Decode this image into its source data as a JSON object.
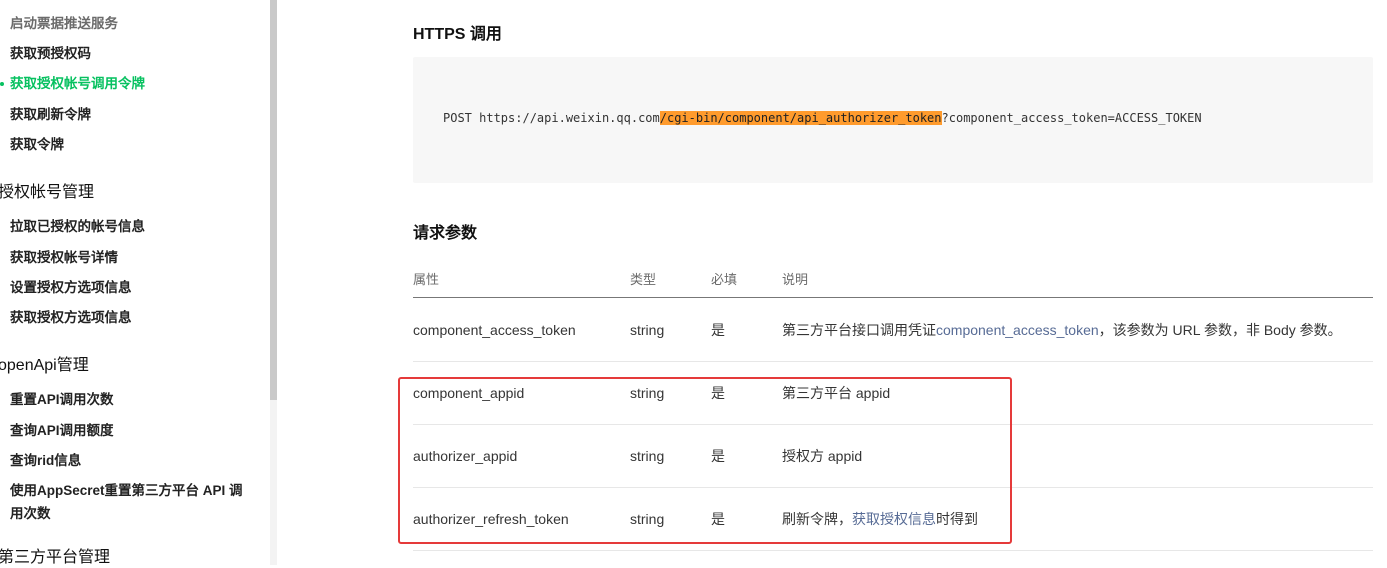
{
  "sidebar": {
    "items": [
      {
        "label": "启动票据推送服务"
      },
      {
        "label": "获取预授权码"
      },
      {
        "label": "获取授权帐号调用令牌"
      },
      {
        "label": "获取刷新令牌"
      },
      {
        "label": "获取令牌"
      }
    ],
    "groups": [
      {
        "title": "授权帐号管理",
        "items": [
          "拉取已授权的帐号信息",
          "获取授权帐号详情",
          "设置授权方选项信息",
          "获取授权方选项信息"
        ]
      },
      {
        "title": "openApi管理",
        "items": [
          "重置API调用次数",
          "查询API调用额度",
          "查询rid信息",
          "使用AppSecret重置第三方平台 API 调用次数"
        ]
      },
      {
        "title": "第三方平台管理"
      }
    ]
  },
  "main": {
    "https_title": "HTTPS 调用",
    "code": {
      "prefix": "POST https://api.weixin.qq.com",
      "highlight": "/cgi-bin/component/api_authorizer_token",
      "suffix": "?component_access_token=ACCESS_TOKEN"
    },
    "params_title": "请求参数",
    "table": {
      "headers": [
        "属性",
        "类型",
        "必填",
        "说明"
      ],
      "rows": [
        {
          "name": "component_access_token",
          "type": "string",
          "required": "是",
          "desc_pre": "第三方平台接口调用凭证",
          "desc_link": "component_access_token",
          "desc_post": "，该参数为 URL 参数，非 Body 参数。"
        },
        {
          "name": "component_appid",
          "type": "string",
          "required": "是",
          "desc_pre": "第三方平台 appid",
          "desc_link": "",
          "desc_post": ""
        },
        {
          "name": "authorizer_appid",
          "type": "string",
          "required": "是",
          "desc_pre": "授权方 appid",
          "desc_link": "",
          "desc_post": ""
        },
        {
          "name": "authorizer_refresh_token",
          "type": "string",
          "required": "是",
          "desc_pre": "刷新令牌，",
          "desc_link": "获取授权信息",
          "desc_post": "时得到"
        }
      ]
    }
  },
  "colors": {
    "accent_green": "#07c160",
    "link_blue": "#576b95",
    "code_highlight": "#ff9b2d",
    "annotation_red": "#e53a3a"
  }
}
